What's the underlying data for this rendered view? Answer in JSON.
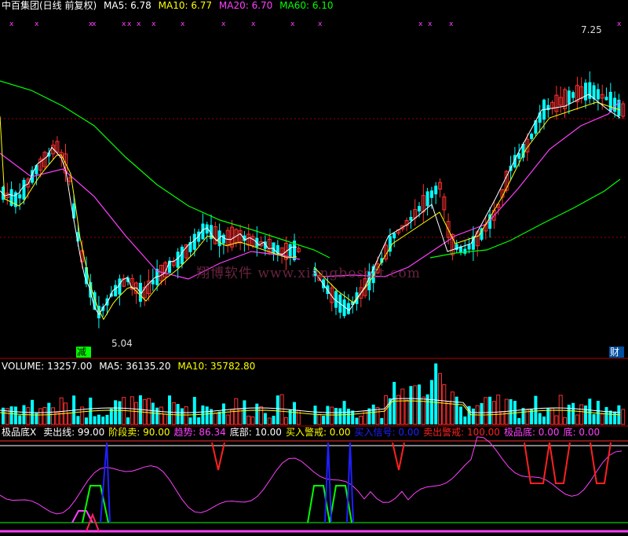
{
  "header": {
    "stock_title": "中百集团(日线 前复权)",
    "ma5": "MA5: 6.78",
    "ma10": "MA10: 6.77",
    "ma20": "MA20: 6.70",
    "ma60": "MA60: 6.10"
  },
  "price_panel": {
    "high_label": "7.25",
    "low_label": "5.04",
    "marker_left": "减",
    "marker_right": "财",
    "watermark": "翔博软件 www.xiangbosoft.com"
  },
  "volume_header": {
    "volume": "VOLUME: 13257.00",
    "ma5": "MA5: 36135.20",
    "ma10": "MA10: 35782.80"
  },
  "indicator_header": {
    "name": "极品底X",
    "items": [
      {
        "text": "卖出线: 99.00",
        "color": "#ffffff"
      },
      {
        "text": "阶段卖: 90.00",
        "color": "#ffff00"
      },
      {
        "text": "趋势: 86.34",
        "color": "#ff40ff"
      },
      {
        "text": "底部: 10.00",
        "color": "#ffffff"
      },
      {
        "text": "买入警戒: 0.00",
        "color": "#ffff00"
      },
      {
        "text": "买入信号: 0.00",
        "color": "#2020ff"
      },
      {
        "text": "卖出警戒: 100.00",
        "color": "#ff2020"
      },
      {
        "text": "极品底: 0.00",
        "color": "#ff40ff"
      },
      {
        "text": "底: 0.00",
        "color": "#ff40ff"
      }
    ]
  },
  "colors": {
    "ma5": "#ffffff",
    "ma10": "#ffff00",
    "ma20": "#ff40ff",
    "ma60": "#00ff00",
    "up": "#ff3030",
    "down": "#00ffff",
    "grid": "#a00000"
  }
}
